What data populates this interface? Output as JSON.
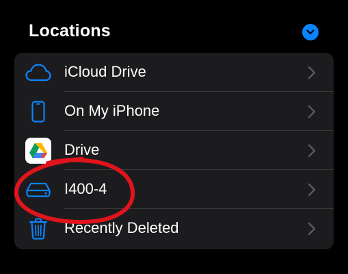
{
  "section": {
    "title": "Locations",
    "collapse_icon": "chevron-down-icon"
  },
  "colors": {
    "accent": "#0a84ff",
    "background": "#000000",
    "card": "#1c1c1e",
    "annotation": "#e0141c"
  },
  "locations": [
    {
      "label": "iCloud Drive",
      "icon": "cloud-icon"
    },
    {
      "label": "On My iPhone",
      "icon": "iphone-icon"
    },
    {
      "label": "Drive",
      "icon": "google-drive-logo"
    },
    {
      "label": "I400-4",
      "icon": "external-drive-icon"
    },
    {
      "label": "Recently Deleted",
      "icon": "trash-icon"
    }
  ]
}
